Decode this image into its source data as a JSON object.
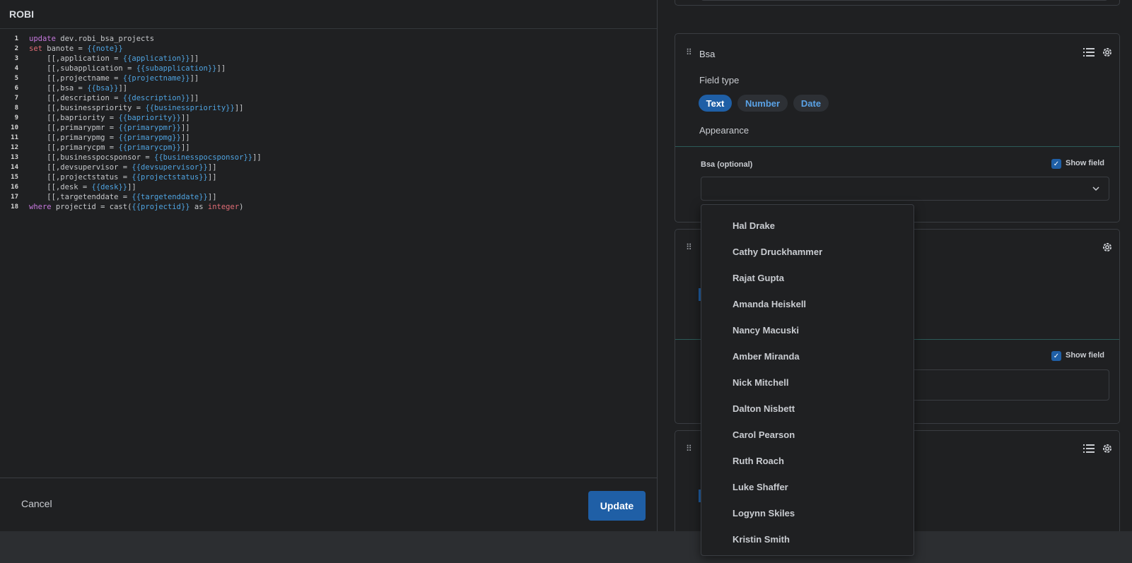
{
  "app": {
    "title": "ROBI"
  },
  "editor": {
    "lines": [
      {
        "n": "1",
        "parts": [
          {
            "t": "update",
            "c": "kw"
          },
          {
            "t": " dev.robi_bsa_projects",
            "c": ""
          }
        ]
      },
      {
        "n": "2",
        "parts": [
          {
            "t": "set",
            "c": "kw2"
          },
          {
            "t": " banote = ",
            "c": ""
          },
          {
            "t": "{{note}}",
            "c": "ph"
          }
        ]
      },
      {
        "n": "3",
        "parts": [
          {
            "t": "    [[,application = ",
            "c": ""
          },
          {
            "t": "{{application}}",
            "c": "ph"
          },
          {
            "t": "]]",
            "c": ""
          }
        ]
      },
      {
        "n": "4",
        "parts": [
          {
            "t": "    [[,subapplication = ",
            "c": ""
          },
          {
            "t": "{{subapplication}}",
            "c": "ph"
          },
          {
            "t": "]]",
            "c": ""
          }
        ]
      },
      {
        "n": "5",
        "parts": [
          {
            "t": "    [[,projectname = ",
            "c": ""
          },
          {
            "t": "{{projectname}}",
            "c": "ph"
          },
          {
            "t": "]]",
            "c": ""
          }
        ]
      },
      {
        "n": "6",
        "parts": [
          {
            "t": "    [[,bsa = ",
            "c": ""
          },
          {
            "t": "{{bsa}}",
            "c": "ph"
          },
          {
            "t": "]]",
            "c": ""
          }
        ]
      },
      {
        "n": "7",
        "parts": [
          {
            "t": "    [[,description = ",
            "c": ""
          },
          {
            "t": "{{description}}",
            "c": "ph"
          },
          {
            "t": "]]",
            "c": ""
          }
        ]
      },
      {
        "n": "8",
        "parts": [
          {
            "t": "    [[,businesspriority = ",
            "c": ""
          },
          {
            "t": "{{businesspriority}}",
            "c": "ph"
          },
          {
            "t": "]]",
            "c": ""
          }
        ]
      },
      {
        "n": "9",
        "parts": [
          {
            "t": "    [[,bapriority = ",
            "c": ""
          },
          {
            "t": "{{bapriority}}",
            "c": "ph"
          },
          {
            "t": "]]",
            "c": ""
          }
        ]
      },
      {
        "n": "10",
        "parts": [
          {
            "t": "    [[,primarypmr = ",
            "c": ""
          },
          {
            "t": "{{primarypmr}}",
            "c": "ph"
          },
          {
            "t": "]]",
            "c": ""
          }
        ]
      },
      {
        "n": "11",
        "parts": [
          {
            "t": "    [[,primarypmg = ",
            "c": ""
          },
          {
            "t": "{{primarypmg}}",
            "c": "ph"
          },
          {
            "t": "]]",
            "c": ""
          }
        ]
      },
      {
        "n": "12",
        "parts": [
          {
            "t": "    [[,primarycpm = ",
            "c": ""
          },
          {
            "t": "{{primarycpm}}",
            "c": "ph"
          },
          {
            "t": "]]",
            "c": ""
          }
        ]
      },
      {
        "n": "13",
        "parts": [
          {
            "t": "    [[,businesspocsponsor = ",
            "c": ""
          },
          {
            "t": "{{businesspocsponsor}}",
            "c": "ph"
          },
          {
            "t": "]]",
            "c": ""
          }
        ]
      },
      {
        "n": "14",
        "parts": [
          {
            "t": "    [[,devsupervisor = ",
            "c": ""
          },
          {
            "t": "{{devsupervisor}}",
            "c": "ph"
          },
          {
            "t": "]]",
            "c": ""
          }
        ]
      },
      {
        "n": "15",
        "parts": [
          {
            "t": "    [[,projectstatus = ",
            "c": ""
          },
          {
            "t": "{{projectstatus}}",
            "c": "ph"
          },
          {
            "t": "]]",
            "c": ""
          }
        ]
      },
      {
        "n": "16",
        "parts": [
          {
            "t": "    [[,desk = ",
            "c": ""
          },
          {
            "t": "{{desk}}",
            "c": "ph"
          },
          {
            "t": "]]",
            "c": ""
          }
        ]
      },
      {
        "n": "17",
        "parts": [
          {
            "t": "    [[,targetenddate = ",
            "c": ""
          },
          {
            "t": "{{targetenddate}}",
            "c": "ph"
          },
          {
            "t": "]]",
            "c": ""
          }
        ]
      },
      {
        "n": "18",
        "parts": [
          {
            "t": "where",
            "c": "kw"
          },
          {
            "t": " projectid = cast(",
            "c": ""
          },
          {
            "t": "{{projectid}}",
            "c": "ph"
          },
          {
            "t": " as ",
            "c": ""
          },
          {
            "t": "integer",
            "c": "ty"
          },
          {
            "t": ")",
            "c": ""
          }
        ]
      }
    ]
  },
  "footer": {
    "cancel_label": "Cancel",
    "update_label": "Update"
  },
  "bsa_card": {
    "name": "Bsa",
    "field_type_label": "Field type",
    "types": [
      "Text",
      "Number",
      "Date"
    ],
    "active_type": "Text",
    "appearance_label": "Appearance",
    "field_label": "Bsa",
    "optional_label": "(optional)",
    "show_field_label": "Show field",
    "show_field_checked": true
  },
  "card2": {
    "show_field_label": "Show field",
    "show_field_checked": true
  },
  "dropdown": {
    "options": [
      "Hal Drake",
      "Cathy Druckhammer",
      "Rajat Gupta",
      "Amanda Heiskell",
      "Nancy Macuski",
      "Amber Miranda",
      "Nick Mitchell",
      "Dalton Nisbett",
      "Carol Pearson",
      "Ruth Roach",
      "Luke Shaffer",
      "Logynn Skiles",
      "Kristin Smith"
    ]
  },
  "icons": {
    "drag": "drag-handle-icon",
    "list": "list-icon",
    "settings": "gear-icon",
    "chevron": "chevron-down-icon",
    "check": "check-icon"
  },
  "colors": {
    "accent": "#1f5fa6",
    "link": "#5aa2e6",
    "background": "#1f2022",
    "divider": "#2c5b58"
  }
}
